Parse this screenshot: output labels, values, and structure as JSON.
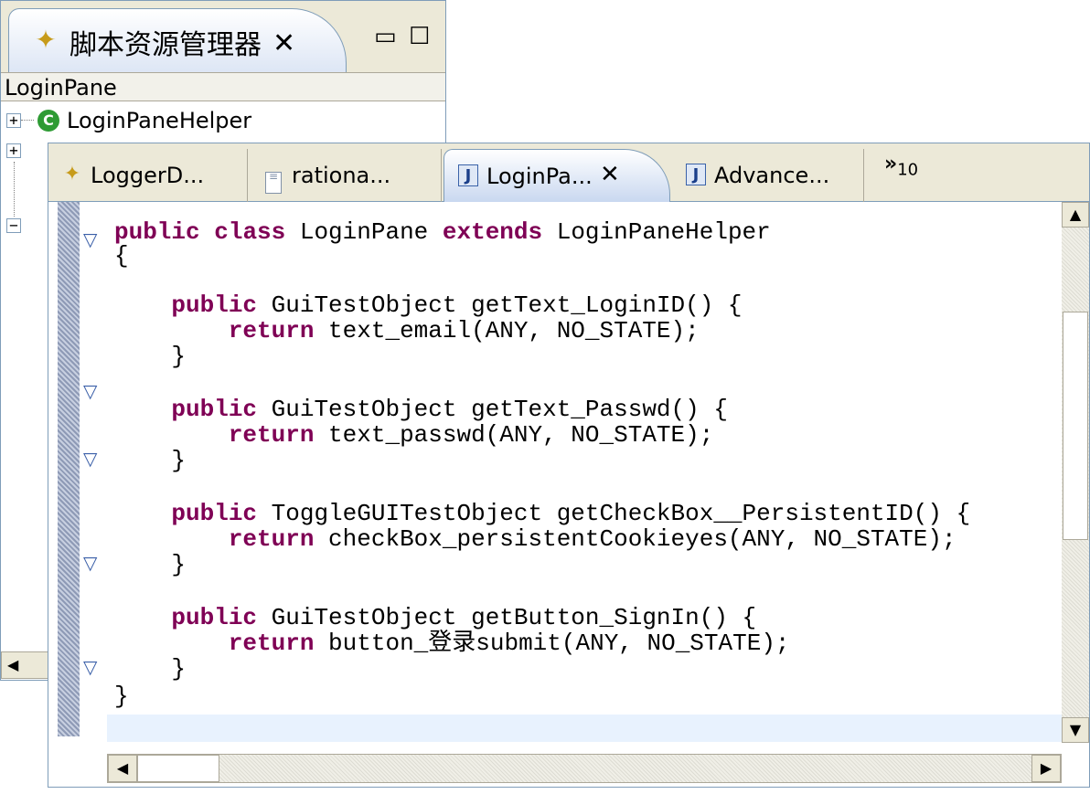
{
  "explorer": {
    "title": "脚本资源管理器",
    "close_glyph": "✕",
    "min_glyph": "▭",
    "max_glyph": "☐",
    "breadcrumb": "LoginPane",
    "tree": {
      "helper_label": "LoginPaneHelper",
      "helper_icon": "C",
      "expander_collapsed": "+",
      "expander_expanded": "−"
    },
    "hscroll_left_glyph": "◀"
  },
  "editor": {
    "tabs": [
      {
        "label": "LoggerD...",
        "icon": "logger-script-icon"
      },
      {
        "label": "rationa...",
        "icon": "text-document-icon"
      },
      {
        "label": "LoginPa...",
        "icon": "java-file-icon"
      },
      {
        "label": "Advance...",
        "icon": "java-file-icon"
      }
    ],
    "active_tab_index": 2,
    "active_tab_close": "✕",
    "more_tabs_glyph": "»",
    "more_tabs_count": "10",
    "fold_glyph": "▽",
    "code": {
      "lines": [
        {
          "kw1": "public",
          "sp1": " ",
          "kw2": "class",
          "rest1": " LoginPane ",
          "kw3": "extends",
          "rest2": " LoginPaneHelper"
        },
        {
          "text": "{"
        },
        {
          "text": ""
        },
        {
          "indent": "    ",
          "kw": "public",
          "rest": " GuiTestObject getText_LoginID() {"
        },
        {
          "indent": "        ",
          "kw": "return",
          "rest": " text_email(ANY, NO_STATE);"
        },
        {
          "text": "    }"
        },
        {
          "text": ""
        },
        {
          "indent": "    ",
          "kw": "public",
          "rest": " GuiTestObject getText_Passwd() {"
        },
        {
          "indent": "        ",
          "kw": "return",
          "rest": " text_passwd(ANY, NO_STATE);"
        },
        {
          "text": "    }"
        },
        {
          "text": ""
        },
        {
          "indent": "    ",
          "kw": "public",
          "rest": " ToggleGUITestObject getCheckBox__PersistentID() {"
        },
        {
          "indent": "        ",
          "kw": "return",
          "rest": " checkBox_persistentCookieyes(ANY, NO_STATE);"
        },
        {
          "text": "    }"
        },
        {
          "text": ""
        },
        {
          "indent": "    ",
          "kw": "public",
          "rest": " GuiTestObject getButton_SignIn() {"
        },
        {
          "indent": "        ",
          "kw": "return",
          "rest": " button_登录submit(ANY, NO_STATE);"
        },
        {
          "text": "    }"
        },
        {
          "text": "}"
        }
      ]
    },
    "scroll": {
      "up": "▲",
      "down": "▼",
      "left": "◀",
      "right": "▶"
    }
  }
}
